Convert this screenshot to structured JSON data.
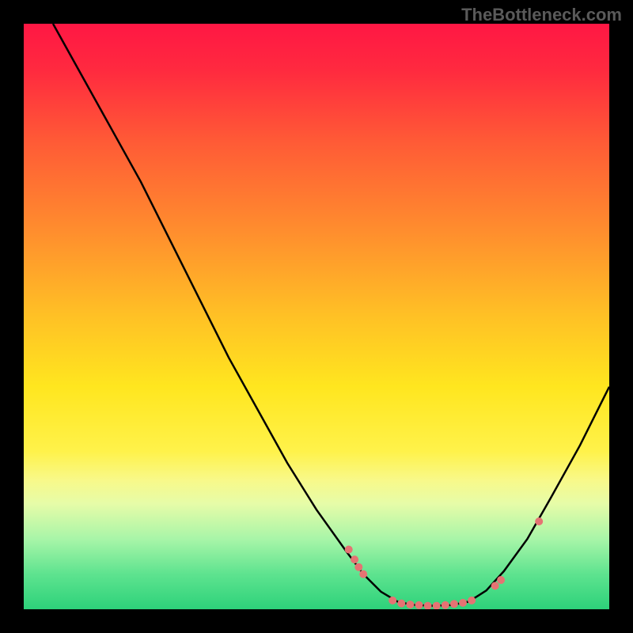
{
  "watermark": "TheBottleneck.com",
  "chart_data": {
    "type": "line",
    "title": "",
    "xlabel": "",
    "ylabel": "",
    "xlim": [
      0,
      100
    ],
    "ylim": [
      0,
      100
    ],
    "gradient_stops": [
      {
        "offset": 0,
        "color": "#ff1744"
      },
      {
        "offset": 8,
        "color": "#ff2a3f"
      },
      {
        "offset": 20,
        "color": "#ff5a36"
      },
      {
        "offset": 35,
        "color": "#ff8c2e"
      },
      {
        "offset": 50,
        "color": "#ffc125"
      },
      {
        "offset": 62,
        "color": "#ffe61f"
      },
      {
        "offset": 73,
        "color": "#fff24a"
      },
      {
        "offset": 78,
        "color": "#f8f98a"
      },
      {
        "offset": 82,
        "color": "#e6fca8"
      },
      {
        "offset": 88,
        "color": "#a8f5a8"
      },
      {
        "offset": 94,
        "color": "#5ee38f"
      },
      {
        "offset": 100,
        "color": "#2dd27a"
      }
    ],
    "curve": [
      {
        "x": 5,
        "y": 100
      },
      {
        "x": 10,
        "y": 91
      },
      {
        "x": 15,
        "y": 82
      },
      {
        "x": 20,
        "y": 73
      },
      {
        "x": 25,
        "y": 63
      },
      {
        "x": 30,
        "y": 53
      },
      {
        "x": 35,
        "y": 43
      },
      {
        "x": 40,
        "y": 34
      },
      {
        "x": 45,
        "y": 25
      },
      {
        "x": 50,
        "y": 17
      },
      {
        "x": 55,
        "y": 10
      },
      {
        "x": 58,
        "y": 6
      },
      {
        "x": 61,
        "y": 3
      },
      {
        "x": 64,
        "y": 1.2
      },
      {
        "x": 67,
        "y": 0.7
      },
      {
        "x": 70,
        "y": 0.6
      },
      {
        "x": 73,
        "y": 0.7
      },
      {
        "x": 76,
        "y": 1.3
      },
      {
        "x": 79,
        "y": 3.2
      },
      {
        "x": 82,
        "y": 6.5
      },
      {
        "x": 86,
        "y": 12
      },
      {
        "x": 90,
        "y": 19
      },
      {
        "x": 95,
        "y": 28
      },
      {
        "x": 100,
        "y": 38
      }
    ],
    "points": [
      {
        "x": 55.5,
        "y": 10.2
      },
      {
        "x": 56.5,
        "y": 8.5
      },
      {
        "x": 57.2,
        "y": 7.2
      },
      {
        "x": 58.0,
        "y": 6.0
      },
      {
        "x": 63.0,
        "y": 1.5
      },
      {
        "x": 64.5,
        "y": 1.0
      },
      {
        "x": 66.0,
        "y": 0.8
      },
      {
        "x": 67.5,
        "y": 0.7
      },
      {
        "x": 69.0,
        "y": 0.6
      },
      {
        "x": 70.5,
        "y": 0.6
      },
      {
        "x": 72.0,
        "y": 0.7
      },
      {
        "x": 73.5,
        "y": 0.9
      },
      {
        "x": 75.0,
        "y": 1.1
      },
      {
        "x": 76.5,
        "y": 1.5
      },
      {
        "x": 80.5,
        "y": 4.0
      },
      {
        "x": 81.5,
        "y": 5.0
      },
      {
        "x": 88.0,
        "y": 15.0
      }
    ],
    "point_color": "#e57373",
    "point_radius": 5
  }
}
